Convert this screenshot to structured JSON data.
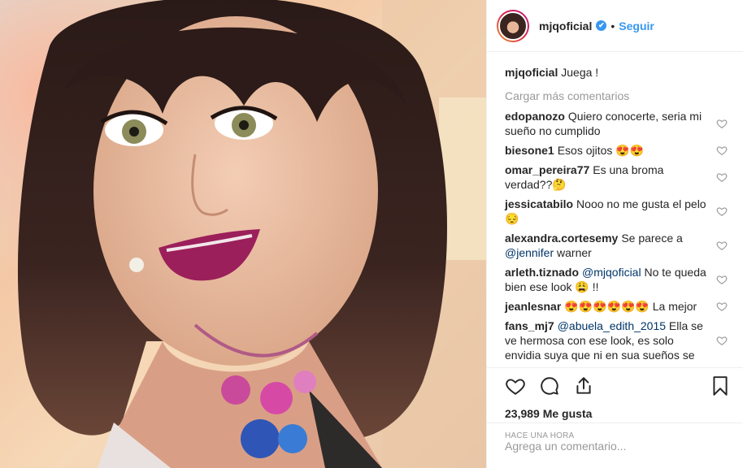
{
  "header": {
    "username": "mjqoficial",
    "verified_mark": "✔",
    "separator": "•",
    "follow_label": "Seguir"
  },
  "caption": {
    "user": "mjqoficial",
    "text": "Juega !"
  },
  "load_more_label": "Cargar más comentarios",
  "comments": [
    {
      "user": "edopanozo",
      "text": "Quiero conocerte, seria mi sueño no cumplido"
    },
    {
      "user": "biesone1",
      "text": "Esos ojitos 😍😍"
    },
    {
      "user": "omar_pereira77",
      "text": "Es una broma verdad??🤔"
    },
    {
      "user": "jessicatabilo",
      "text": "Nooo no me gusta el pelo😔"
    },
    {
      "user": "alexandra.cortesemy",
      "pre": "Se parece a ",
      "mention": "@jennifer",
      "post": " warner"
    },
    {
      "user": "arleth.tiznado",
      "mention": "@mjqoficial",
      "post": " No te queda bien ese look 😩 !!"
    },
    {
      "user": "jeanlesnar",
      "text": "😍😍😍😍😍😍 La mejor"
    },
    {
      "user": "fans_mj7",
      "mention": "@abuela_edith_2015",
      "post": " Ella se ve hermosa con ese look, es solo envidia suya que ni en sua sueños se"
    }
  ],
  "likes": "23,989 Me gusta",
  "timestamp": "HACE UNA HORA",
  "add_comment_placeholder": "Agrega un comentario...",
  "icons": [
    "heart-icon",
    "comment-icon",
    "share-icon",
    "bookmark-icon"
  ],
  "colors": {
    "link": "#3897f0",
    "mention": "#003569",
    "muted": "#999999"
  }
}
